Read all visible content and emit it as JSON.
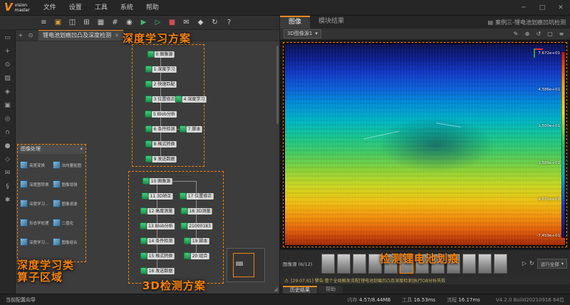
{
  "titlebar": {
    "logo": {
      "mark": "V",
      "line1": "vision",
      "line2": "master"
    },
    "menus": [
      "文件",
      "设置",
      "工具",
      "系统",
      "帮助"
    ],
    "window_controls": [
      {
        "name": "minimize-button",
        "glyph": "─"
      },
      {
        "name": "maximize-button",
        "glyph": "□"
      },
      {
        "name": "close-button",
        "glyph": "✕"
      }
    ]
  },
  "toolbar": {
    "icons": [
      {
        "name": "menu-icon",
        "glyph": "≡",
        "color": "#c8c8c8"
      },
      {
        "name": "open-solution-icon",
        "glyph": "▣",
        "color": "#d89a3c"
      },
      {
        "name": "save-solution-icon",
        "glyph": "◫",
        "color": "#c8c8c8"
      },
      {
        "name": "new-flow-icon",
        "glyph": "⊞",
        "color": "#c8c8c8"
      },
      {
        "name": "module-list-icon",
        "glyph": "▦",
        "color": "#c8c8c8"
      },
      {
        "name": "grid-view-icon",
        "glyph": "#",
        "color": "#c8c8c8"
      },
      {
        "name": "record-icon",
        "glyph": "◉",
        "color": "#c8c8c8"
      },
      {
        "name": "run-all-icon",
        "glyph": "▶",
        "color": "#46b96e"
      },
      {
        "name": "run-once-icon",
        "glyph": "▷",
        "color": "#46b96e"
      },
      {
        "name": "stop-icon",
        "glyph": "■",
        "color": "#c85050"
      },
      {
        "name": "message-icon",
        "glyph": "✉",
        "color": "#c8c8c8"
      },
      {
        "name": "marker-icon",
        "glyph": "◆",
        "color": "#c8c8c8"
      },
      {
        "name": "refresh-icon",
        "glyph": "↻",
        "color": "#c8c8c8"
      },
      {
        "name": "help-icon",
        "glyph": "?",
        "color": "#c8c8c8"
      }
    ],
    "solution_icon": {
      "glyph": "▤"
    },
    "solution_name": "案例三-锂电池划痕凹坑检测"
  },
  "left_rail": {
    "icons": [
      {
        "name": "pointer-tool-icon",
        "glyph": "▭"
      },
      {
        "name": "pan-tool-icon",
        "glyph": "+"
      },
      {
        "name": "zoom-tool-icon",
        "glyph": "⊙"
      },
      {
        "name": "image-source-icon",
        "glyph": "▧"
      },
      {
        "name": "deep-learning-icon",
        "glyph": "◈"
      },
      {
        "name": "match-tool-icon",
        "glyph": "▣"
      },
      {
        "name": "location-tool-icon",
        "glyph": "◎"
      },
      {
        "name": "measure-tool-icon",
        "glyph": "∩"
      },
      {
        "name": "blob-tool-icon",
        "glyph": "●"
      },
      {
        "name": "logic-tool-icon",
        "glyph": "◇"
      },
      {
        "name": "comm-tool-icon",
        "glyph": "✉"
      },
      {
        "name": "script-tool-icon",
        "glyph": "§"
      },
      {
        "name": "settings-tool-icon",
        "glyph": "✱"
      }
    ]
  },
  "canvas": {
    "tab": "锂电池划痕凹凸及深度检测",
    "tab_close": "✕",
    "tools": [
      {
        "name": "pan-canvas-icon",
        "glyph": "+"
      },
      {
        "name": "zoom-canvas-icon",
        "glyph": "⊙"
      }
    ],
    "resize_grip": "◢"
  },
  "annotations": {
    "flow1": "深度学习方案",
    "flow2": "3D检测方案",
    "operators_line1": "深度学习类",
    "operators_line2": "算子区域",
    "detect": "检测锂电池划痕"
  },
  "operator_panel": {
    "title": "图像处理",
    "caret": "▾",
    "items": [
      "亮度变换",
      "法向量贴图",
      "深度图转换",
      "图像增强",
      "深度学习训练",
      "图像滤波",
      "形态学处理",
      "二值化",
      "深度学习推理",
      "图像组合"
    ]
  },
  "flows": [
    {
      "name": "deep-learning-flow",
      "nodes": [
        {
          "label": "0 图像源",
          "col": 1,
          "row": 0
        },
        {
          "label": "1 深度学习",
          "col": 1,
          "row": 1
        },
        {
          "label": "2 快速匹配",
          "col": 1,
          "row": 2
        },
        {
          "label": "3 位置修正",
          "col": 1,
          "row": 3
        },
        {
          "label": "4 深度学习",
          "col": 2,
          "row": 3
        },
        {
          "label": "5 Blob分析",
          "col": 1,
          "row": 4
        },
        {
          "label": "6 条件检测",
          "col": 1,
          "row": 5
        },
        {
          "label": "7 脚本",
          "col": 2,
          "row": 5
        },
        {
          "label": "8 格式转换",
          "col": 1,
          "row": 6
        },
        {
          "label": "9 发送数据",
          "col": 1,
          "row": 7
        }
      ]
    },
    {
      "name": "3d-detect-flow",
      "nodes": [
        {
          "label": "10 图像源",
          "col": 1,
          "row": 0
        },
        {
          "label": "11 3D矫正",
          "col": 1,
          "row": 1
        },
        {
          "label": "17 位置修正",
          "col": 2,
          "row": 1
        },
        {
          "label": "12 高度测量",
          "col": 1,
          "row": 2
        },
        {
          "label": "18 3D测量",
          "col": 2,
          "row": 2
        },
        {
          "label": "13 Blob分析",
          "col": 1,
          "row": 3
        },
        {
          "label": "21000183",
          "col": 2,
          "row": 3
        },
        {
          "label": "14 条件检测",
          "col": 1,
          "row": 4
        },
        {
          "label": "19 脚本",
          "col": 2,
          "row": 4
        },
        {
          "label": "15 格式转换",
          "col": 1,
          "row": 5
        },
        {
          "label": "20 组合",
          "col": 2,
          "row": 5
        },
        {
          "label": "16 发送数据",
          "col": 1,
          "row": 6
        }
      ]
    }
  ],
  "right_panel": {
    "tabs": [
      {
        "label": "图像",
        "active": true
      },
      {
        "label": "模块结果",
        "active": false
      }
    ],
    "viewer": {
      "source_label": "3D图像源1",
      "caret": "▾",
      "icons": [
        {
          "name": "edit-overlay-icon",
          "glyph": "✎"
        },
        {
          "name": "crosshair-icon",
          "glyph": "⊕"
        },
        {
          "name": "undo-view-icon",
          "glyph": "↺"
        },
        {
          "name": "fit-view-icon",
          "glyph": "▢"
        },
        {
          "name": "more-view-icon",
          "glyph": "≡"
        }
      ],
      "colorbar_labels": [
        "7.672e+01",
        "4.586e+01",
        "1.500e+01",
        "-1.586e+01",
        "-4.672e+01",
        "-7.459e+01"
      ]
    },
    "filmstrip": {
      "label": "图像源 (6/12)",
      "count": 12,
      "active_index": 5,
      "play_glyph": "▷",
      "loop_glyph": "↻",
      "run_label": "运行全部",
      "caret": "▾"
    },
    "warning": {
      "glyph": "⚠",
      "text": "[29:07.61] 警告:整个全局触发流程[锂电池划痕凹凸及深度检测]执行OB分析失败"
    },
    "bottom_tabs": [
      {
        "label": "历史结果",
        "active": true
      },
      {
        "label": "帮助",
        "active": false
      }
    ]
  },
  "statusbar": {
    "left": "当前配置向导",
    "metrics": [
      {
        "label": "内存",
        "value": "4.57/8.44MB"
      },
      {
        "label": "工具",
        "value": "16.53ms"
      },
      {
        "label": "流程",
        "value": "16.17ms"
      }
    ],
    "version": "V4.2.0 Build20210916 64位"
  },
  "colors": {
    "accent": "#f28a1e",
    "node_green": "#2fae62",
    "run_green": "#46b96e",
    "stop_red": "#c85050"
  }
}
